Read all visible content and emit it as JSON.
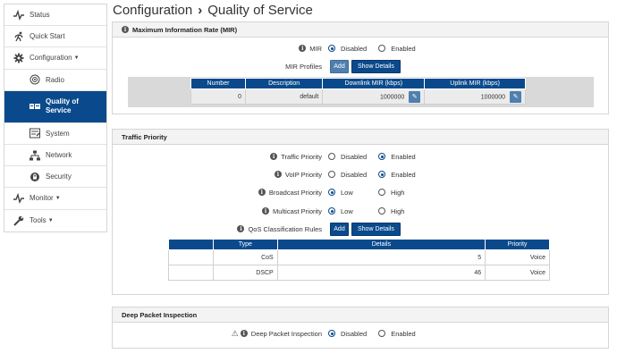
{
  "sidebar": {
    "items": [
      {
        "label": "Status",
        "icon": "pulse-icon"
      },
      {
        "label": "Quick Start",
        "icon": "runner-icon"
      },
      {
        "label": "Configuration",
        "icon": "gear-icon"
      },
      {
        "label": "Radio",
        "icon": "radio-icon"
      },
      {
        "label": "Quality of Service",
        "icon": "qos-icon"
      },
      {
        "label": "System",
        "icon": "system-icon"
      },
      {
        "label": "Network",
        "icon": "network-icon"
      },
      {
        "label": "Security",
        "icon": "lock-icon"
      },
      {
        "label": "Monitor",
        "icon": "pulse-icon"
      },
      {
        "label": "Tools",
        "icon": "wrench-icon"
      }
    ]
  },
  "breadcrumb": {
    "parent": "Configuration",
    "separator": "›",
    "current": "Quality of Service"
  },
  "mir": {
    "title": "Maximum Information Rate (MIR)",
    "mir_label": "MIR",
    "options": [
      "Disabled",
      "Enabled"
    ],
    "selected": "Disabled",
    "profiles_label": "MIR Profiles",
    "add_label": "Add",
    "details_label": "Show Details",
    "table": {
      "headers": [
        "Number",
        "Description",
        "Downlink MIR (kbps)",
        "Uplink MIR (kbps)"
      ],
      "rows": [
        {
          "number": "0",
          "description": "default",
          "downlink": "1000000",
          "uplink": "1000000"
        }
      ]
    }
  },
  "traffic": {
    "title": "Traffic Priority",
    "rows": [
      {
        "label": "Traffic Priority",
        "options": [
          "Disabled",
          "Enabled"
        ],
        "selected": 1
      },
      {
        "label": "VoIP Priority",
        "options": [
          "Disabled",
          "Enabled"
        ],
        "selected": 1
      },
      {
        "label": "Broadcast Priority",
        "options": [
          "Low",
          "High"
        ],
        "selected": 0
      },
      {
        "label": "Multicast Priority",
        "options": [
          "Low",
          "High"
        ],
        "selected": 0
      }
    ],
    "qos_label": "QoS Classification Rules",
    "add_label": "Add",
    "details_label": "Show Details",
    "table": {
      "headers": [
        "Type",
        "Details",
        "Priority"
      ],
      "rows": [
        {
          "type": "CoS",
          "details": "5",
          "priority": "Voice"
        },
        {
          "type": "DSCP",
          "details": "46",
          "priority": "Voice"
        }
      ]
    }
  },
  "dpi": {
    "title": "Deep Packet Inspection",
    "label": "Deep Packet Inspection",
    "options": [
      "Disabled",
      "Enabled"
    ],
    "selected": 0
  },
  "colors": {
    "accent": "#0a4a8c",
    "accent_light": "#4f7fae"
  }
}
